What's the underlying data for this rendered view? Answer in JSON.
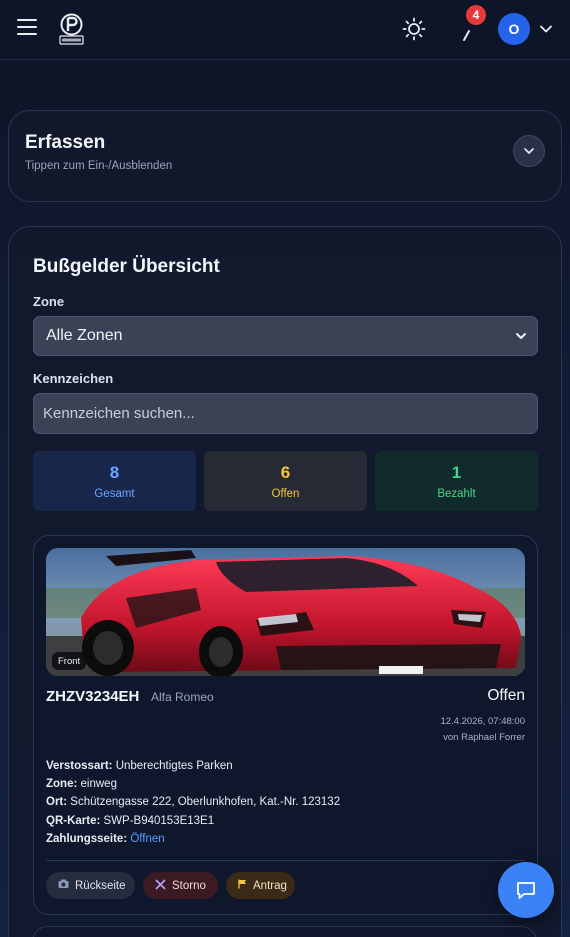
{
  "header": {
    "menu_icon": "hamburger-menu-icon",
    "logo_icon": "parking-logo-icon",
    "theme_icon": "sun-icon",
    "notification_icon": "notification-icon",
    "notification_count": "4",
    "avatar_initial": "O",
    "avatar_chevron_icon": "chevron-down-icon",
    "colors": {
      "avatar": "#2563eb",
      "badge": "#e53a3a"
    }
  },
  "erfassen": {
    "title": "Erfassen",
    "subtitle": "Tippen zum Ein-/Ausblenden",
    "toggle_icon": "chevron-down-icon"
  },
  "overview": {
    "title": "Bußgelder Übersicht",
    "zone_label": "Zone",
    "zone_selected": "Alle Zonen",
    "plate_label": "Kennzeichen",
    "plate_placeholder": "Kennzeichen suchen...",
    "stats": {
      "total": {
        "value": "8",
        "label": "Gesamt",
        "color": "#6aa6ff"
      },
      "open": {
        "value": "6",
        "label": "Offen",
        "color": "#f5c542"
      },
      "paid": {
        "value": "1",
        "label": "Bezahlt",
        "color": "#4ad488"
      }
    }
  },
  "fines": [
    {
      "photo_tag": "Front",
      "plate": "ZHZV3234EH",
      "brand": "Alfa Romeo",
      "status": "Offen",
      "datetime": "12.4.2026, 07:48:00",
      "officer": "von Raphael Forrer",
      "violation_label": "Verstossart:",
      "violation": "Unberechtigtes Parken",
      "zone_label": "Zone:",
      "zone": "einweg",
      "location_label": "Ort:",
      "location": "Schützengasse 222, Oberlunkhofen, Kat.-Nr. 123132",
      "qr_label": "QR-Karte:",
      "qr": "SWP-B940153E13E1",
      "payment_label": "Zahlungsseite:",
      "payment_link": "Öffnen",
      "actions": {
        "back": "Rückseite",
        "storno": "Storno",
        "antrag": "Antrag"
      }
    }
  ],
  "fab_icon": "chat-icon"
}
